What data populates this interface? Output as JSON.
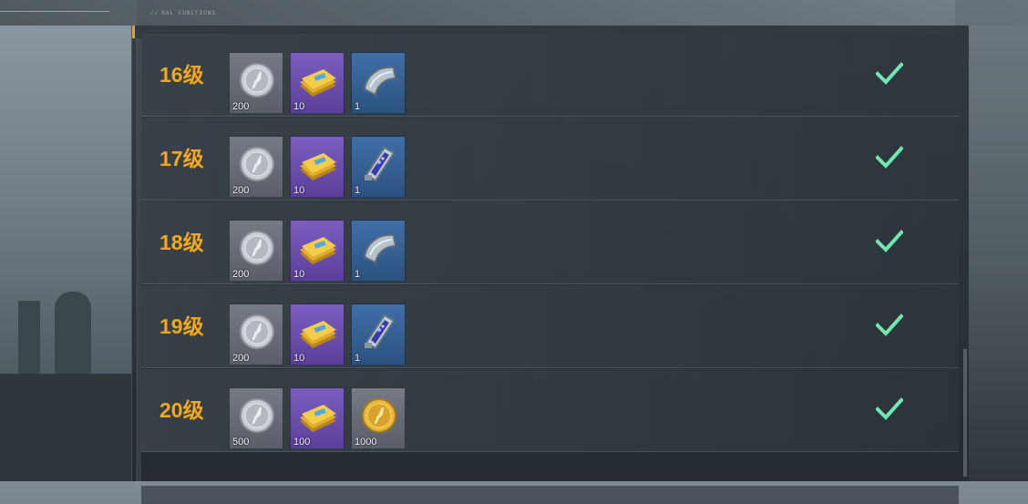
{
  "header": {
    "caption": "RAL FUNCTIONS"
  },
  "colors": {
    "level_text": "#f2a81d",
    "check": "#6fe8b0"
  },
  "rows": [
    {
      "level": "16级",
      "items": [
        {
          "icon": "silver-coin-icon",
          "rarity": "gray",
          "qty": "200"
        },
        {
          "icon": "gold-ticket-stack-icon",
          "rarity": "purple",
          "qty": "10"
        },
        {
          "icon": "armor-plate-icon",
          "rarity": "blue",
          "qty": "1"
        }
      ],
      "claimed": true
    },
    {
      "level": "17级",
      "items": [
        {
          "icon": "silver-coin-icon",
          "rarity": "gray",
          "qty": "200"
        },
        {
          "icon": "gold-ticket-stack-icon",
          "rarity": "purple",
          "qty": "10"
        },
        {
          "icon": "chip-module-icon",
          "rarity": "blue",
          "qty": "1"
        }
      ],
      "claimed": true
    },
    {
      "level": "18级",
      "items": [
        {
          "icon": "silver-coin-icon",
          "rarity": "gray",
          "qty": "200"
        },
        {
          "icon": "gold-ticket-stack-icon",
          "rarity": "purple",
          "qty": "10"
        },
        {
          "icon": "armor-plate-icon",
          "rarity": "blue",
          "qty": "1"
        }
      ],
      "claimed": true
    },
    {
      "level": "19级",
      "items": [
        {
          "icon": "silver-coin-icon",
          "rarity": "gray",
          "qty": "200"
        },
        {
          "icon": "gold-ticket-stack-icon",
          "rarity": "purple",
          "qty": "10"
        },
        {
          "icon": "chip-module-icon",
          "rarity": "blue",
          "qty": "1"
        }
      ],
      "claimed": true
    },
    {
      "level": "20级",
      "items": [
        {
          "icon": "silver-coin-icon",
          "rarity": "gray",
          "qty": "500"
        },
        {
          "icon": "gold-ticket-stack-icon",
          "rarity": "purple",
          "qty": "100"
        },
        {
          "icon": "gold-coin-icon",
          "rarity": "gray",
          "qty": "1000"
        }
      ],
      "claimed": true
    }
  ]
}
